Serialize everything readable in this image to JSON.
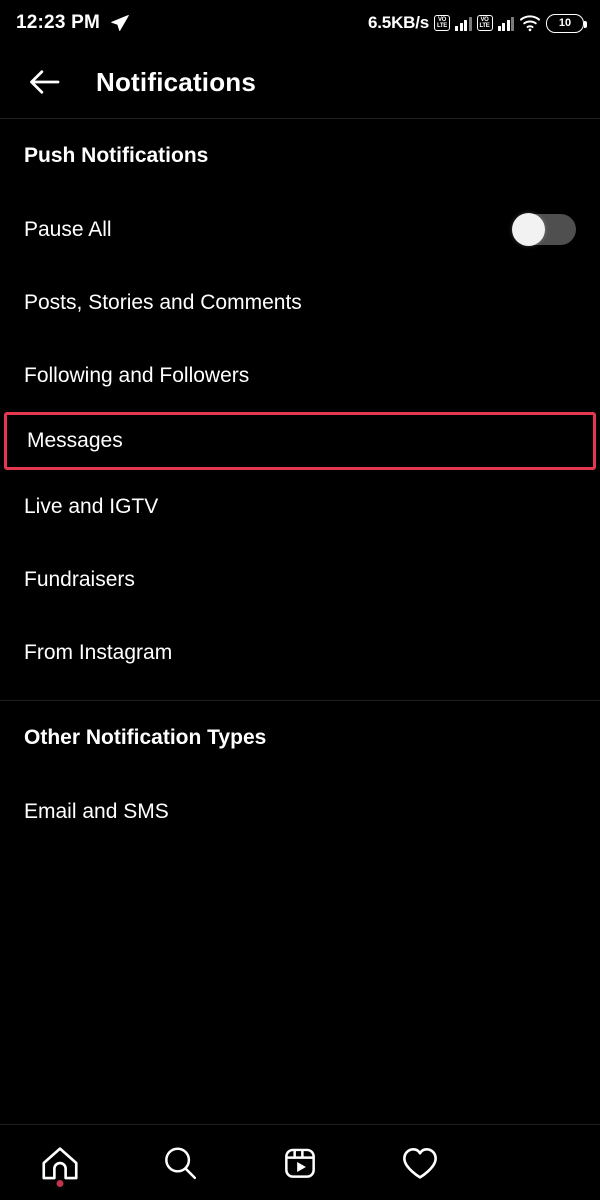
{
  "status_bar": {
    "time": "12:23 PM",
    "telegram_icon": "telegram-send-icon",
    "network_speed": "6.5KB/s",
    "sim1_label": "VoLTE",
    "sim1_top": "VO",
    "sim1_bottom": "LTE",
    "sim2_top": "VO",
    "sim2_bottom": "LTE",
    "wifi_icon": "wifi-icon",
    "battery_level": "10"
  },
  "header": {
    "back_icon": "back-arrow-icon",
    "title": "Notifications"
  },
  "sections": [
    {
      "title": "Push Notifications",
      "items": [
        {
          "label": "Pause All",
          "control": "toggle",
          "toggle_on": false
        },
        {
          "label": "Posts, Stories and Comments",
          "control": "none"
        },
        {
          "label": "Following and Followers",
          "control": "none"
        },
        {
          "label": "Messages",
          "control": "none",
          "highlighted": true
        },
        {
          "label": "Live and IGTV",
          "control": "none"
        },
        {
          "label": "Fundraisers",
          "control": "none"
        },
        {
          "label": "From Instagram",
          "control": "none"
        }
      ]
    },
    {
      "title": "Other Notification Types",
      "items": [
        {
          "label": "Email and SMS",
          "control": "none"
        }
      ]
    }
  ],
  "bottom_nav": [
    {
      "icon": "home-icon",
      "badge": true
    },
    {
      "icon": "search-icon",
      "badge": false
    },
    {
      "icon": "reels-icon",
      "badge": false
    },
    {
      "icon": "heart-icon",
      "badge": false
    },
    {
      "icon": "profile-avatar-icon",
      "badge": false
    }
  ],
  "colors": {
    "background": "#000000",
    "text": "#ffffff",
    "highlight_border": "#e4384f",
    "toggle_track": "#4f4f4f",
    "toggle_knob": "#f2f2f2",
    "divider": "#1e1e1e",
    "badge_dot": "#c2344a"
  }
}
